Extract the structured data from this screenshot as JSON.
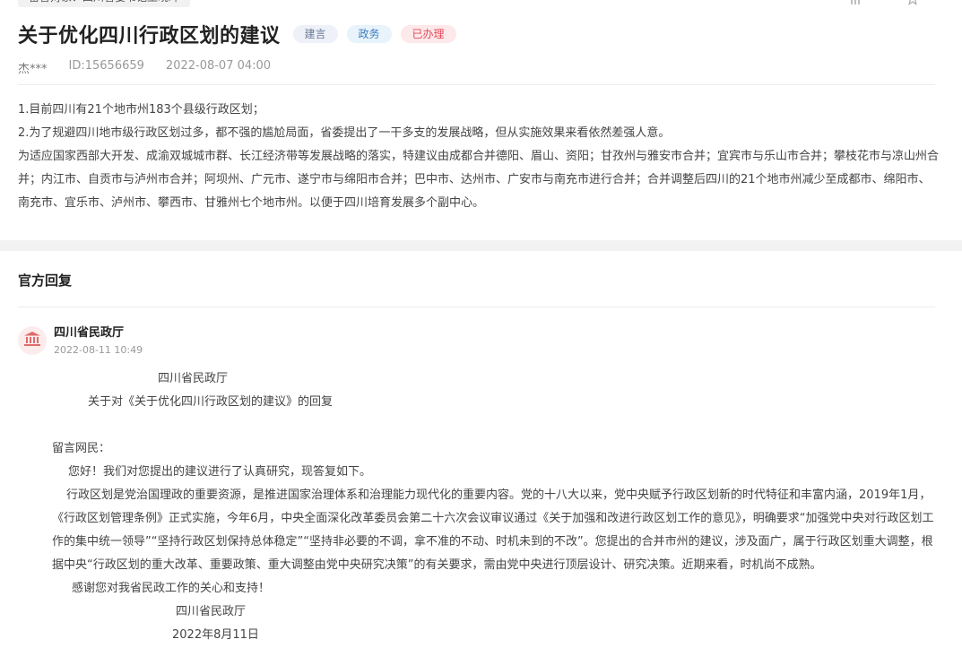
{
  "post": {
    "recipient_tag": "留言对象：四川省委书记王晓晖",
    "title": "关于优化四川行政区划的建议",
    "tags": [
      "建言",
      "政务",
      "已办理"
    ],
    "author": "杰***",
    "id": "ID:15656659",
    "date": "2022-08-07 04:00",
    "paragraphs": [
      "1.目前四川有21个地市州183个县级行政区划；",
      "2.为了规避四川地市级行政区划过多，都不强的尴尬局面，省委提出了一干多支的发展战略，但从实施效果来看依然差强人意。",
      "为适应国家西部大开发、成渝双城城市群、长江经济带等发展战略的落实，特建议由成都合并德阳、眉山、资阳；甘孜州与雅安市合并；宜宾市与乐山市合并；攀枝花市与凉山州合并；内江市、自贡市与泸州市合并；阿坝州、广元市、遂宁市与绵阳市合并；巴中市、达州市、广安市与南充市进行合并；合并调整后四川的21个地市州减少至成都市、绵阳市、南充市、宜乐市、泸州市、攀西市、甘雅州七个地市州。以便于四川培育发展多个副中心。"
    ]
  },
  "reply": {
    "heading": "官方回复",
    "org_name": "四川省民政厅",
    "org_time": "2022-08-11 10:49",
    "line1": "四川省民政厅",
    "line2": "关于对《关于优化四川行政区划的建议》的回复",
    "salutation": "留言网民：",
    "greeting": "您好！我们对您提出的建议进行了认真研究，现答复如下。",
    "main": "行政区划是党治国理政的重要资源，是推进国家治理体系和治理能力现代化的重要内容。党的十八大以来，党中央赋予行政区划新的时代特征和丰富内涵，2019年1月，《行政区划管理条例》正式实施，今年6月，中央全面深化改革委员会第二十六次会议审议通过《关于加强和改进行政区划工作的意见》，明确要求“加强党中央对行政区划工作的集中统一领导”“坚持行政区划保持总体稳定”“坚持非必要的不调，拿不准的不动、时机未到的不改”。您提出的合并市州的建议，涉及面广，属于行政区划重大调整，根据中央“行政区划的重大改革、重要政策、重大调整由党中央研究决策”的有关要求，需由党中央进行顶层设计、研究决策。近期来看，时机尚不成熟。",
    "thanks": "感谢您对我省民政工作的关心和支持！",
    "sign": "四川省民政厅",
    "sign_date": "2022年8月11日"
  },
  "icons": {
    "top_action_1": "share-icon",
    "top_action_2": "star-icon",
    "org_avatar": "government-building-icon"
  },
  "colors": {
    "tag_status": "#e34c5a",
    "avatar_bg": "#fdecec",
    "avatar_fg": "#e06a6a"
  }
}
